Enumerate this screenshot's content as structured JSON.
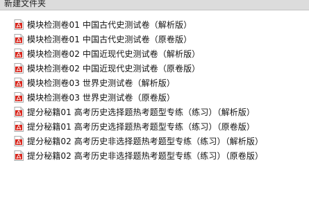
{
  "folder": {
    "title": "新建文件夹"
  },
  "files": [
    {
      "name": "模块检测卷01 中国古代史测试卷（解析版）",
      "icon": "pdf-file-icon"
    },
    {
      "name": "模块检测卷01 中国古代史测试卷（原卷版）",
      "icon": "pdf-file-icon"
    },
    {
      "name": "模块检测卷02 中国近现代史测试卷（解析版）",
      "icon": "pdf-file-icon"
    },
    {
      "name": "模块检测卷02 中国近现代史测试卷（原卷版）",
      "icon": "pdf-file-icon"
    },
    {
      "name": "模块检测卷03 世界史测试卷（解析版）",
      "icon": "pdf-file-icon"
    },
    {
      "name": "模块检测卷03 世界史测试卷（原卷版）",
      "icon": "pdf-file-icon"
    },
    {
      "name": "提分秘籍01 高考历史选择题热考题型专练（练习）（解析版）",
      "icon": "pdf-file-icon"
    },
    {
      "name": "提分秘籍01 高考历史选择题热考题型专练（练习）（原卷版）",
      "icon": "pdf-file-icon"
    },
    {
      "name": "提分秘籍02 高考历史非选择题热考题型专练（练习）（解析版）",
      "icon": "pdf-file-icon"
    },
    {
      "name": "提分秘籍02 高考历史非选择题热考题型专练（练习）（原卷版）",
      "icon": "pdf-file-icon"
    }
  ],
  "colors": {
    "pdf_icon_red": "#d9261c",
    "header_background": "#dcdcdc",
    "text": "#111111"
  }
}
